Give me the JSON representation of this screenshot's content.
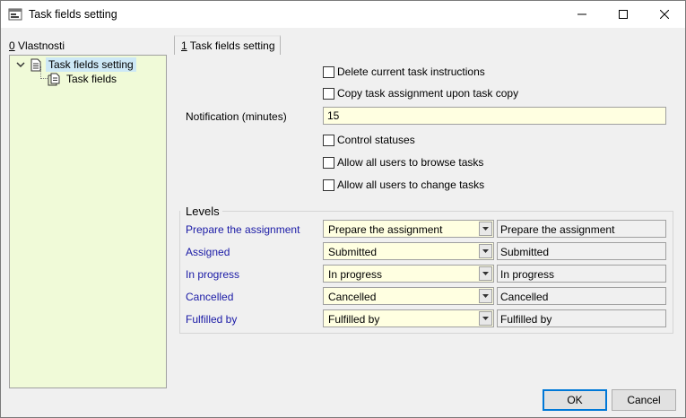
{
  "window": {
    "title": "Task fields setting",
    "icon": "dialog-app-icon"
  },
  "tree": {
    "label_accel": "0",
    "label_rest": " Vlastnosti",
    "nodes": [
      {
        "label": "Task fields setting",
        "icon": "document-icon",
        "expanded": true,
        "selected": true
      },
      {
        "label": "Task fields",
        "icon": "document-stack-icon",
        "selected": false
      }
    ]
  },
  "tab": {
    "accel": "1",
    "label_rest": " Task fields setting"
  },
  "options": {
    "delete_instructions": {
      "label": "Delete current task instructions",
      "checked": false
    },
    "copy_assignment": {
      "label": "Copy task assignment upon task copy",
      "checked": false
    },
    "notification": {
      "label": "Notification (minutes)",
      "value": "15"
    },
    "control_statuses": {
      "label": "Control statuses",
      "checked": false
    },
    "allow_browse": {
      "label": "Allow all users to browse tasks",
      "checked": false
    },
    "allow_change": {
      "label": "Allow all users to change tasks",
      "checked": false
    }
  },
  "levels": {
    "title": "Levels",
    "rows": [
      {
        "label": "Prepare the assignment",
        "selected": "Prepare the assignment",
        "display": "Prepare the assignment"
      },
      {
        "label": "Assigned",
        "selected": "Submitted",
        "display": "Submitted"
      },
      {
        "label": "In progress",
        "selected": "In progress",
        "display": "In progress"
      },
      {
        "label": "Cancelled",
        "selected": "Cancelled",
        "display": "Cancelled"
      },
      {
        "label": "Fulfilled by",
        "selected": "Fulfilled by",
        "display": "Fulfilled by"
      }
    ]
  },
  "buttons": {
    "ok": "OK",
    "cancel": "Cancel"
  },
  "colors": {
    "tree_background": "#f0fad8",
    "input_background": "#ffffe1",
    "level_label": "#1a1aa6",
    "selection": "#cde8f6",
    "default_button_border": "#0078d7"
  }
}
